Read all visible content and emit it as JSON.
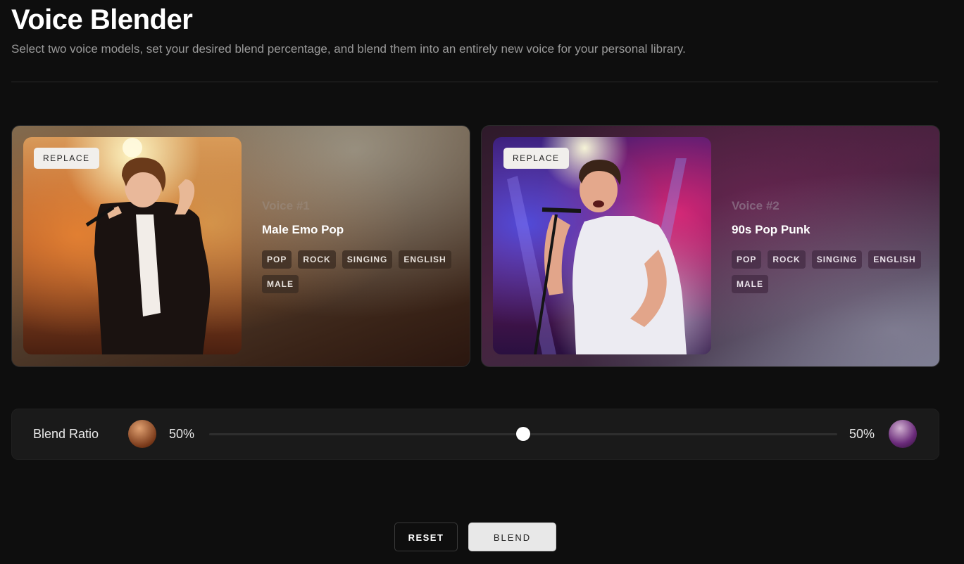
{
  "page": {
    "title": "Voice Blender",
    "subtitle": "Select two voice models, set your desired blend percentage, and blend them into an entirely new voice for your personal library."
  },
  "voices": [
    {
      "label": "Voice #1",
      "name": "Male Emo Pop",
      "replace_label": "REPLACE",
      "tags": [
        "POP",
        "ROCK",
        "SINGING",
        "ENGLISH",
        "MALE"
      ],
      "image": "singer-photo-warm-orange-stage"
    },
    {
      "label": "Voice #2",
      "name": "90s Pop Punk",
      "replace_label": "REPLACE",
      "tags": [
        "POP",
        "ROCK",
        "SINGING",
        "ENGLISH",
        "MALE"
      ],
      "image": "singer-photo-purple-stage-lights"
    }
  ],
  "blend": {
    "label": "Blend Ratio",
    "left_percent": "50%",
    "right_percent": "50%",
    "ratio": 0.5
  },
  "actions": {
    "reset_label": "RESET",
    "blend_label": "BLEND"
  },
  "colors": {
    "background": "#0e0e0e",
    "panel": "#1a1a1a",
    "blend_button": "#e8e8e8"
  }
}
